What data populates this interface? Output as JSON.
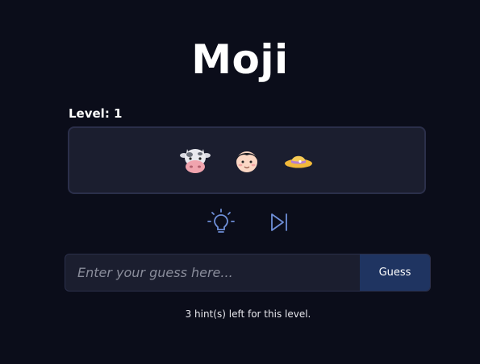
{
  "app": {
    "title": "Moji"
  },
  "level": {
    "label": "Level: 1"
  },
  "puzzle": {
    "emojis": [
      "cow-face",
      "boy-face",
      "straw-hat"
    ]
  },
  "actions": {
    "hint_icon": "lightbulb-icon",
    "skip_icon": "skip-forward-icon"
  },
  "guess": {
    "placeholder": "Enter your guess here...",
    "value": "",
    "button_label": "Guess"
  },
  "status": {
    "hints_left": "3 hint(s) left for this level."
  },
  "colors": {
    "background": "#0b0d1a",
    "panel": "#1b1e2f",
    "panel_border": "#2b2f4a",
    "accent_icon": "#6f8fd8",
    "button": "#1f3461"
  }
}
